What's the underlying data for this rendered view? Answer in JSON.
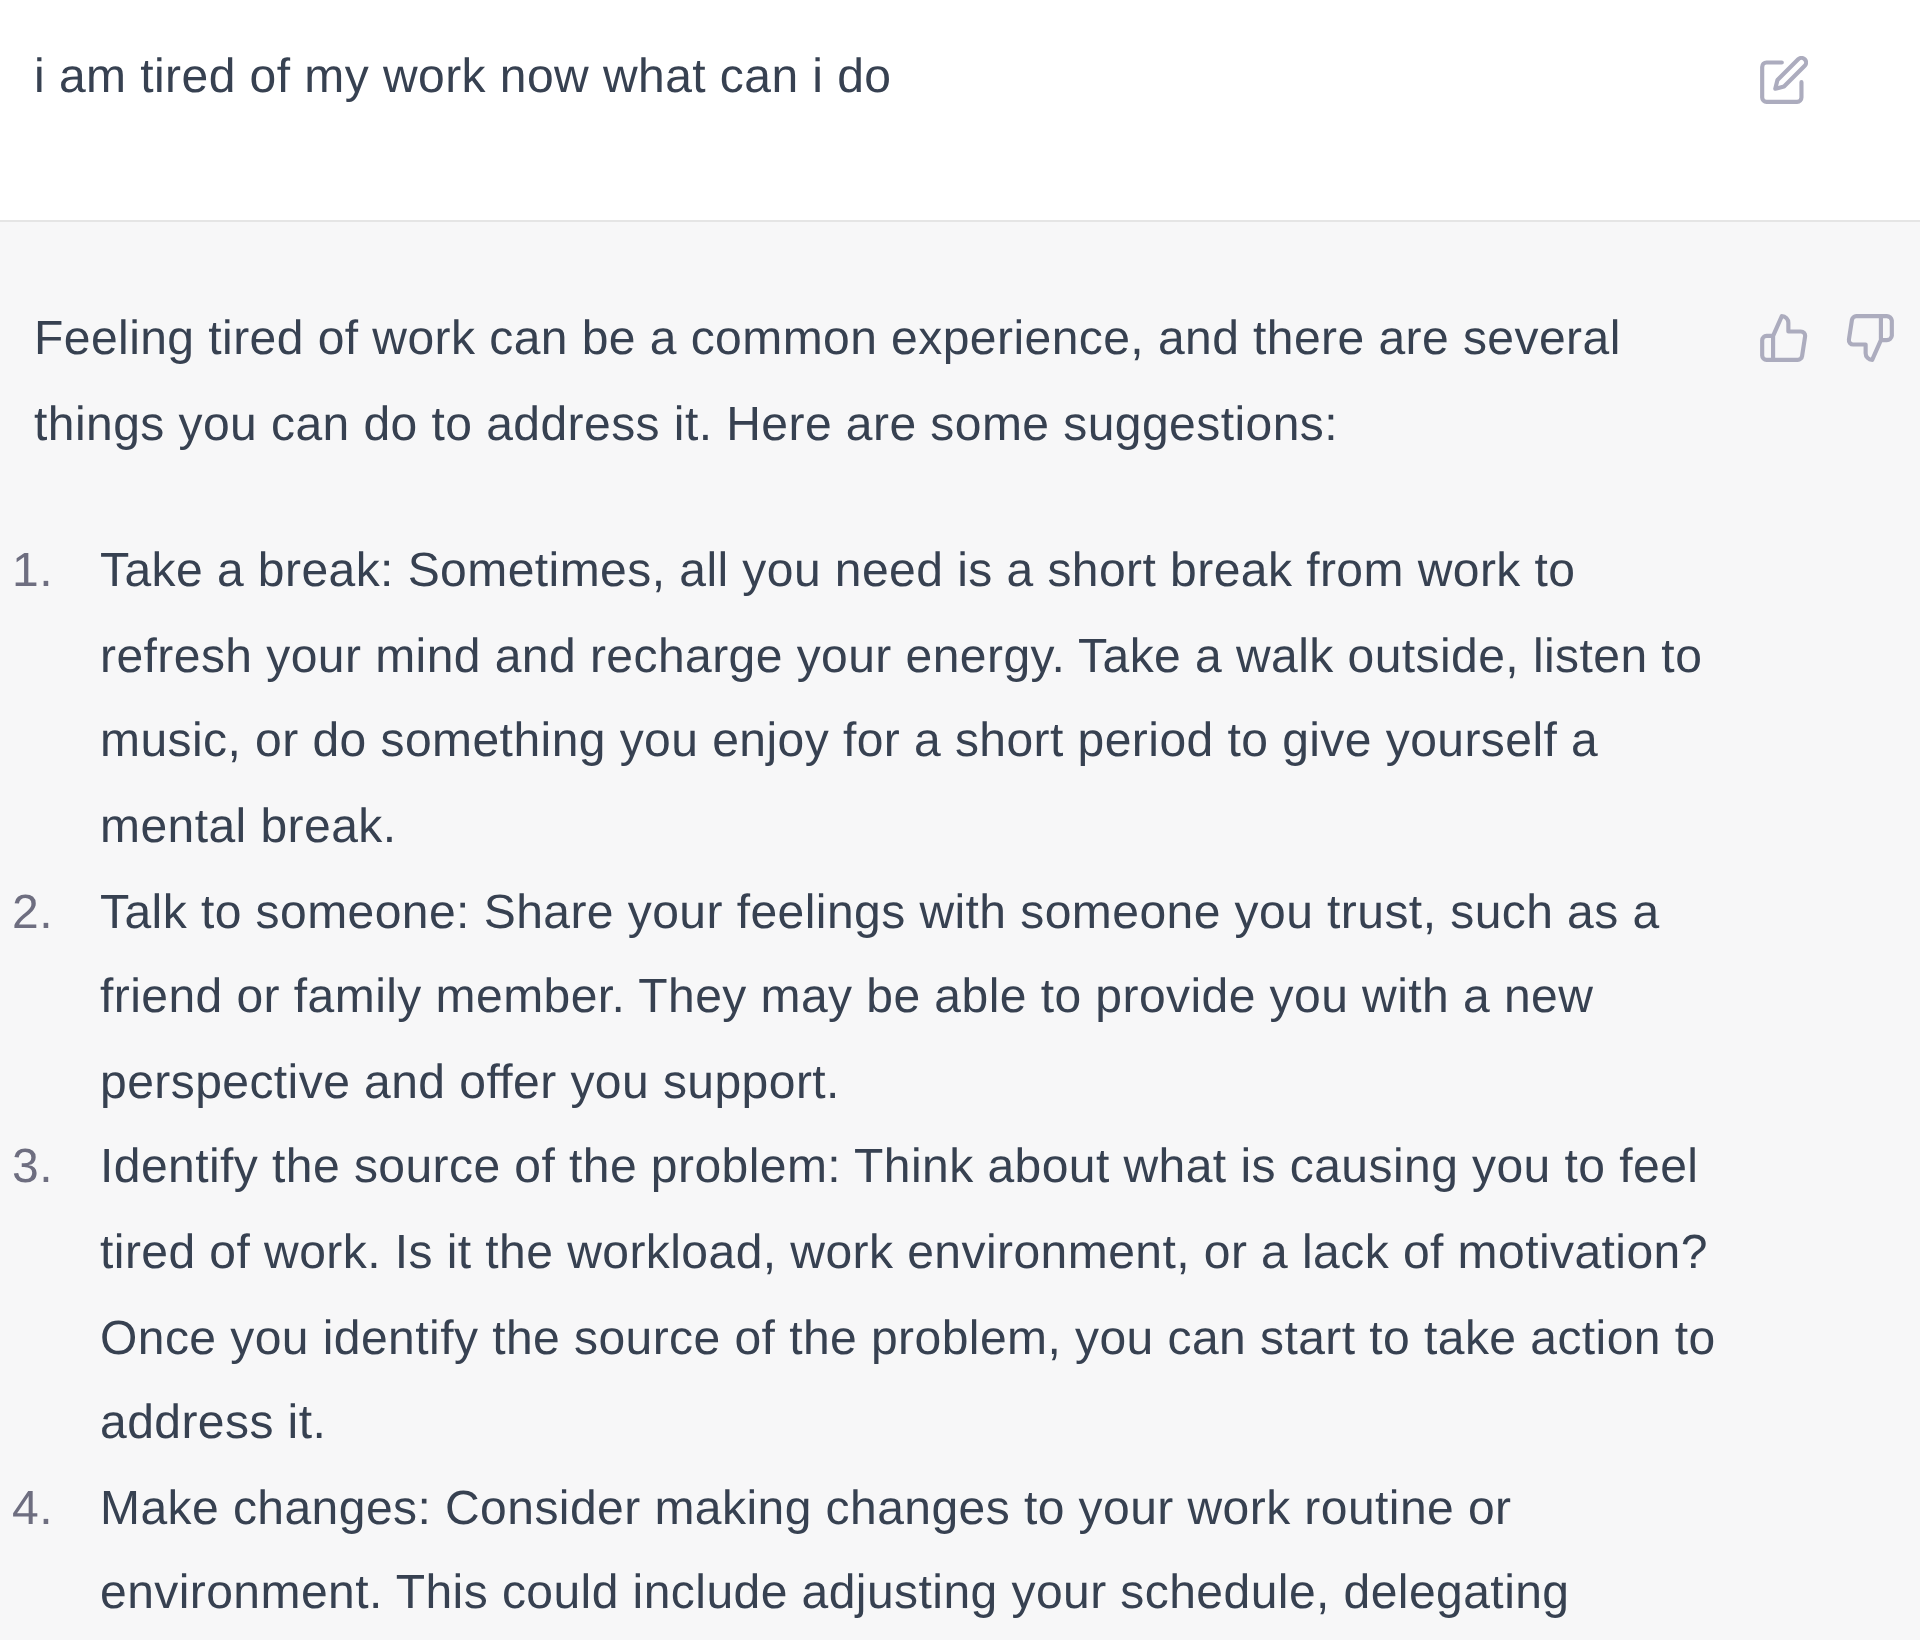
{
  "user_message": {
    "text": "i am tired of my work now what can i do"
  },
  "response": {
    "intro": "Feeling tired of work can be a common experience, and there are several things you can do to address it. Here are some suggestions:",
    "items": [
      {
        "number": "1.",
        "text": "Take a break: Sometimes, all you need is a short break from work to refresh your mind and recharge your energy. Take a walk outside, listen to music, or do something you enjoy for a short period to give yourself a mental break."
      },
      {
        "number": "2.",
        "text": "Talk to someone: Share your feelings with someone you trust, such as a friend or family member. They may be able to provide you with a new perspective and offer you support."
      },
      {
        "number": "3.",
        "text": "Identify the source of the problem: Think about what is causing you to feel tired of work. Is it the workload, work environment, or a lack of motivation? Once you identify the source of the problem, you can start to take action to address it."
      },
      {
        "number": "4.",
        "text": "Make changes: Consider making changes to your work routine or environment. This could include adjusting your schedule, delegating"
      }
    ]
  }
}
